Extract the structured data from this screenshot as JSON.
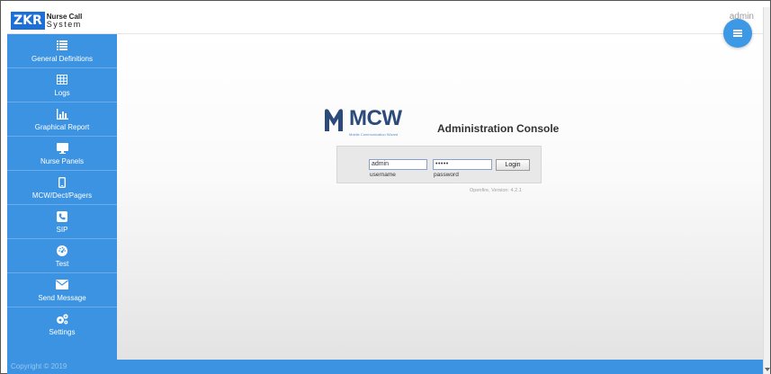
{
  "header": {
    "logo_mark": "ZKR",
    "logo_line1": "Nurse Call",
    "logo_line2": "System",
    "user_label": "admin"
  },
  "sidebar": {
    "items": [
      {
        "label": "General Definitions",
        "icon": "list-icon"
      },
      {
        "label": "Logs",
        "icon": "table-icon"
      },
      {
        "label": "Graphical Report",
        "icon": "bar-chart-icon"
      },
      {
        "label": "Nurse Panels",
        "icon": "monitor-icon"
      },
      {
        "label": "MCW/Dect/Pagers",
        "icon": "mobile-icon"
      },
      {
        "label": "SIP",
        "icon": "phone-icon"
      },
      {
        "label": "Test",
        "icon": "dashboard-icon"
      },
      {
        "label": "Send Message",
        "icon": "envelope-icon"
      },
      {
        "label": "Settings",
        "icon": "gears-icon"
      }
    ]
  },
  "main": {
    "brand_name": "MCW",
    "brand_sub": "Mobile Communication Wizard",
    "console_title": "Administration Console",
    "login": {
      "username_value": "admin",
      "password_value": "•••••",
      "username_label": "username",
      "password_label": "password",
      "button_label": "Login"
    },
    "version": "Openfire, Version: 4.2.1"
  },
  "footer": {
    "copyright": "Copyright © 2019"
  },
  "colors": {
    "sidebar": "#3b93e2",
    "fab": "#3d98e6",
    "brand": "#2c4a7a"
  }
}
